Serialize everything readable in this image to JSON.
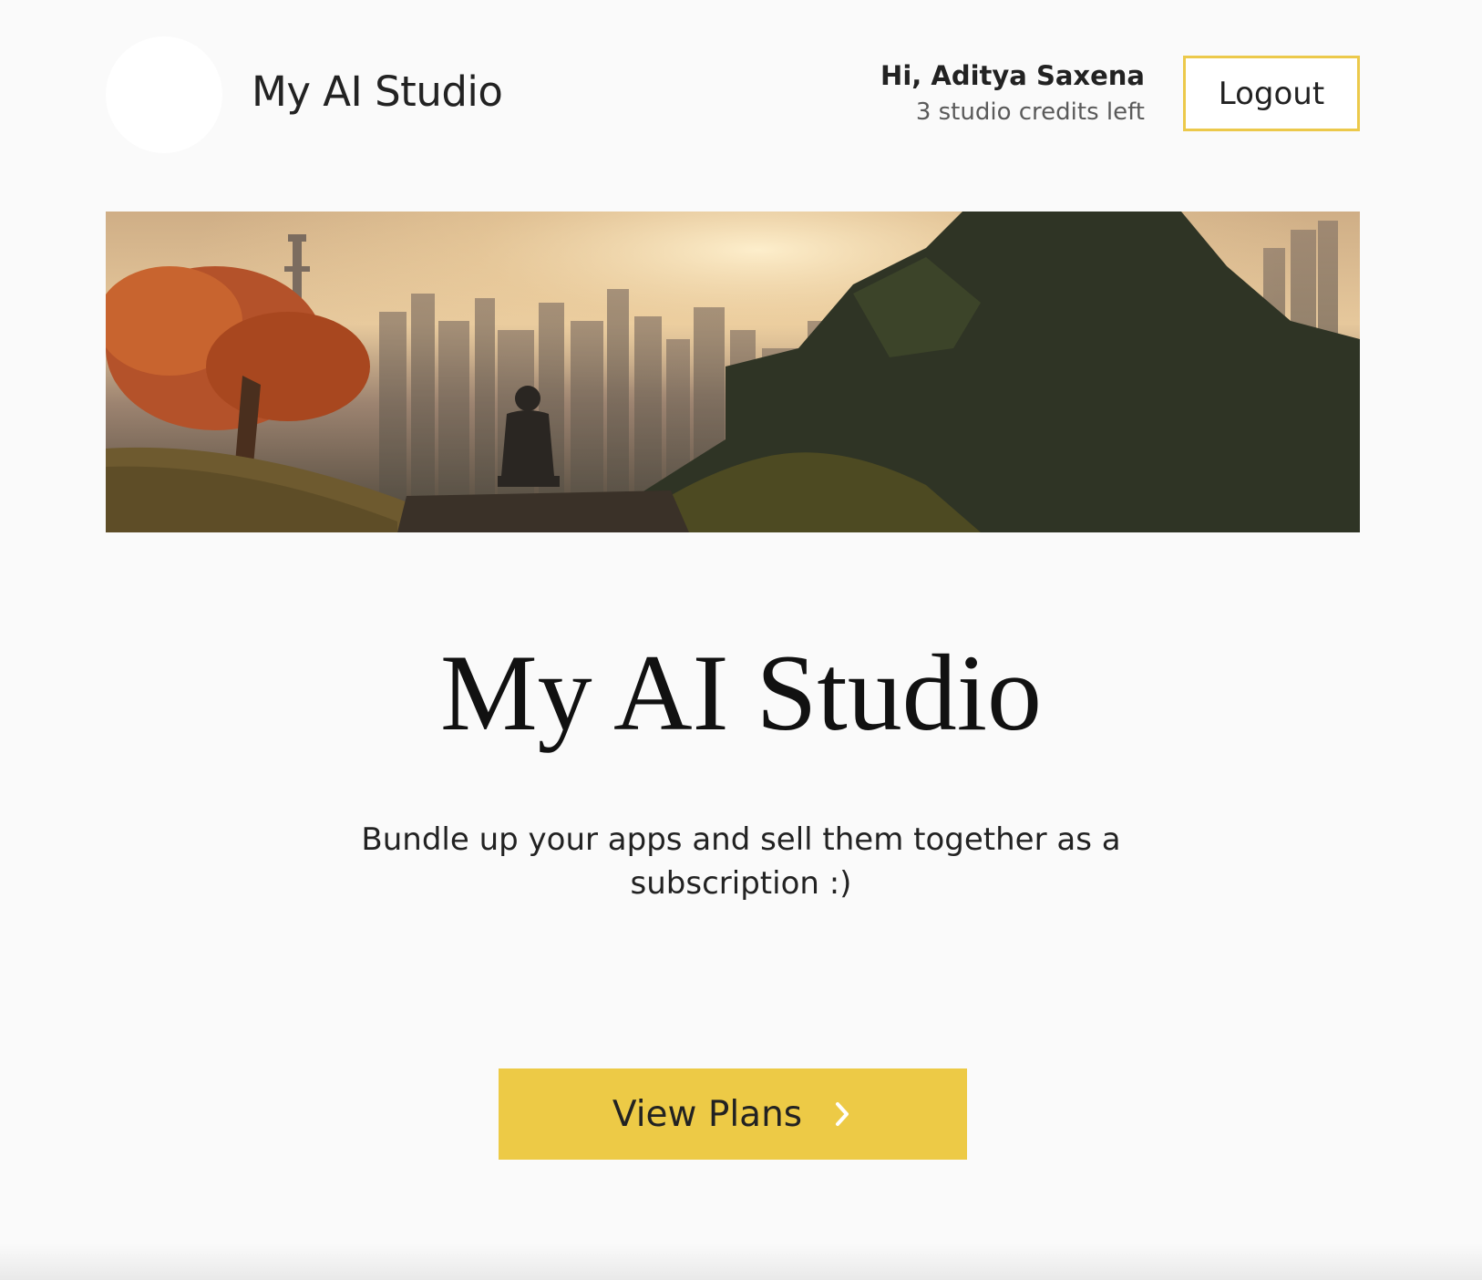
{
  "header": {
    "brand_title": "My AI Studio",
    "greeting": "Hi, Aditya Saxena",
    "credits": "3 studio credits left",
    "logout_label": "Logout"
  },
  "hero": {
    "title": "My AI Studio",
    "subtitle": "Bundle up your apps and sell them together as a subscription :)"
  },
  "cta": {
    "label": "View Plans",
    "icon": "chevron-right-icon"
  },
  "colors": {
    "accent": "#edca46",
    "background": "#fafafa",
    "text": "#222222",
    "muted_text": "#5a5a5a"
  }
}
